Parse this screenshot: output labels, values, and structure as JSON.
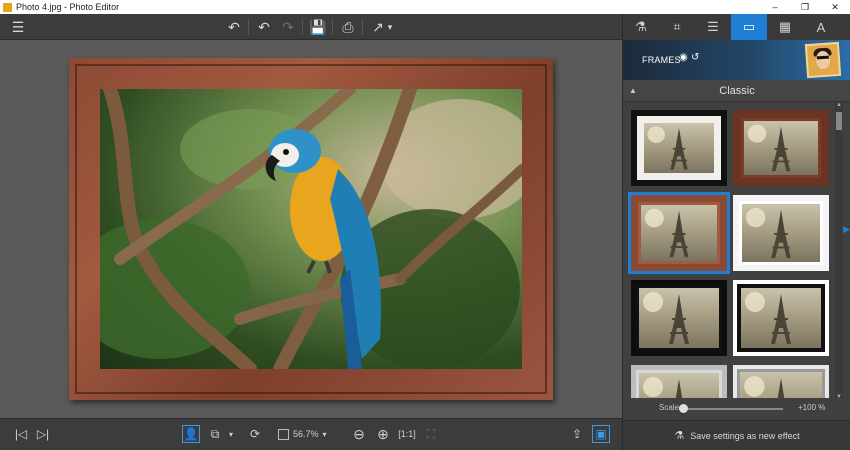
{
  "window": {
    "title": "Photo 4.jpg - Photo Editor",
    "minimize": "–",
    "restore": "❐",
    "close": "✕"
  },
  "toolbar": {
    "menu_icon": "☰",
    "undo_icon": "↶",
    "undo2_icon": "↶",
    "redo_icon": "↷",
    "save_icon": "💾",
    "print_icon": "⎙",
    "share_icon": "↗",
    "share_chevron": "▾"
  },
  "bottombar": {
    "prev_icon": "|◁",
    "next_icon": "▷|",
    "person_icon": "👤",
    "compare_icon": "⧉",
    "compare_chevron": "▾",
    "rotate_icon": "⟳",
    "zoom_value": "56.7%",
    "zoom_chevron": "▾",
    "zoom_out_icon": "⊖",
    "zoom_in_icon": "⊕",
    "fit_icon": "[1:1]",
    "fullscreen_icon": "⛶",
    "export_icon": "⇪",
    "panel_toggle_icon": "▣"
  },
  "panel": {
    "tabs": [
      {
        "name": "effects-tab",
        "icon": "⚗"
      },
      {
        "name": "crop-tab",
        "icon": "⌗"
      },
      {
        "name": "adjust-tab",
        "icon": "☰"
      },
      {
        "name": "frames-tab",
        "icon": "▭"
      },
      {
        "name": "texture-tab",
        "icon": "▦"
      },
      {
        "name": "text-tab",
        "icon": "A"
      }
    ],
    "header_title": "FRAMES",
    "header_eye": "◉",
    "header_reset": "↺",
    "category_arrow": "▲",
    "category": "Classic",
    "thumbnails": [
      {
        "style": "white-mat-black"
      },
      {
        "style": "brown-wood"
      },
      {
        "style": "wood-3d"
      },
      {
        "style": "white-shadow"
      },
      {
        "style": "black-border"
      },
      {
        "style": "black-white-border"
      },
      {
        "style": "silver"
      },
      {
        "style": "grey-white"
      }
    ],
    "selected_thumbnail": 2,
    "scale_label": "Scale",
    "scale_value": "+100 %",
    "scale_level": 0.0,
    "save_label": "Save settings as new effect"
  },
  "colors": {
    "accent": "#1f7fd4"
  }
}
